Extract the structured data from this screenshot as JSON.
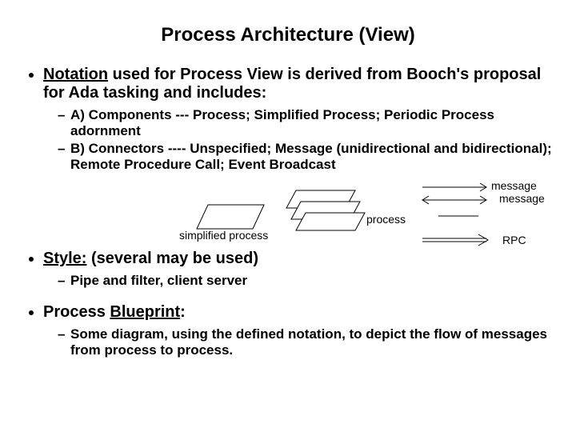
{
  "title": "Process Architecture (View)",
  "bullets": {
    "b1_prefix": "Notation",
    "b1_rest": " used for Process View is derived from Booch's proposal for Ada tasking and includes:",
    "b1a": "A) Components --- Process; Simplified Process; Periodic Process adornment",
    "b1b": "B) Connectors ---- Unspecified; Message (unidirectional and bidirectional); Remote Procedure Call; Event Broadcast",
    "b2_prefix": "Style:",
    "b2_rest": " (several may be used)",
    "b2a": "Pipe and filter, client server",
    "b3_prefix_a": "Process ",
    "b3_prefix_b": "Blueprint",
    "b3_prefix_c": ":",
    "b3a": "Some diagram, using the defined notation, to depict the flow of messages from process to process."
  },
  "diagram": {
    "simplified_process": "simplified process",
    "process": "process",
    "message1": "message",
    "message2": "message",
    "rpc": "RPC"
  }
}
